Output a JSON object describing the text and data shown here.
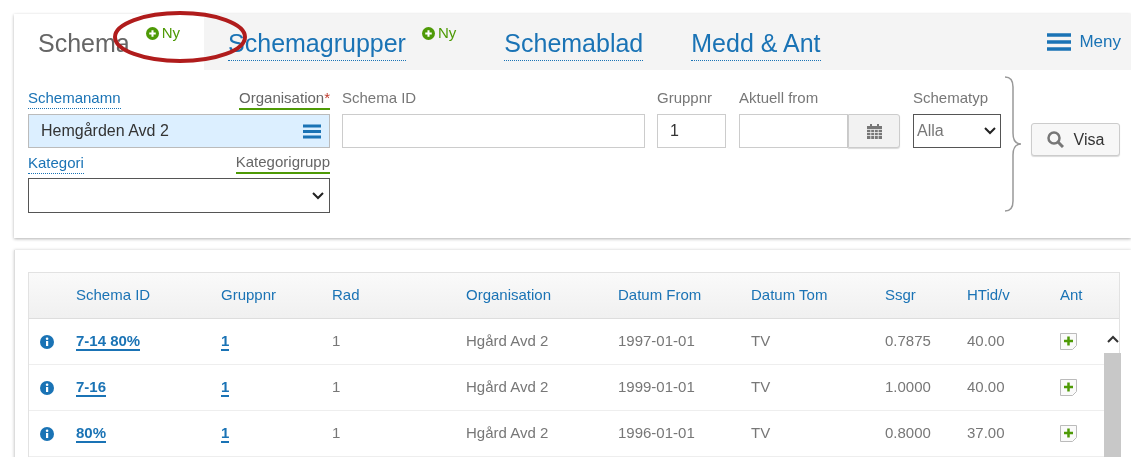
{
  "tabs": [
    {
      "label": "Schema",
      "selected": true,
      "badge": "Ny"
    },
    {
      "label": "Schemagrupper",
      "selected": false,
      "badge": "Ny"
    },
    {
      "label": "Schemablad",
      "selected": false
    },
    {
      "label": "Medd & Ant",
      "selected": false
    }
  ],
  "menu": {
    "label": "Meny"
  },
  "form": {
    "schemanamn": {
      "label": "Schemanamn"
    },
    "organisation": {
      "label": "Organisation",
      "required_mark": "*",
      "value": "Hemgården Avd 2"
    },
    "kategori": {
      "label": "Kategori"
    },
    "kategorigrupp": {
      "label": "Kategorigrupp"
    },
    "schema_id": {
      "label": "Schema ID"
    },
    "gruppnr": {
      "label": "Gruppnr",
      "value": "1"
    },
    "aktuell_from": {
      "label": "Aktuell from"
    },
    "schematyp": {
      "label": "Schematyp",
      "value": "Alla"
    },
    "search_button": "Visa"
  },
  "table": {
    "columns": [
      "Schema ID",
      "Gruppnr",
      "Rad",
      "Organisation",
      "Datum From",
      "Datum Tom",
      "Ssgr",
      "HTid/v",
      "Ant"
    ],
    "rows": [
      [
        "7-14 80%",
        "1",
        "1",
        "Hgård Avd 2",
        "1997-01-01",
        "TV",
        "0.7875",
        "40.00"
      ],
      [
        "7-16",
        "1",
        "1",
        "Hgård Avd 2",
        "1999-01-01",
        "TV",
        "1.0000",
        "40.00"
      ],
      [
        "80%",
        "1",
        "1",
        "Hgård Avd 2",
        "1996-01-01",
        "TV",
        "0.8000",
        "37.00"
      ]
    ]
  },
  "annotation": {
    "kind": "ellipse",
    "color": "#b01c1c"
  }
}
